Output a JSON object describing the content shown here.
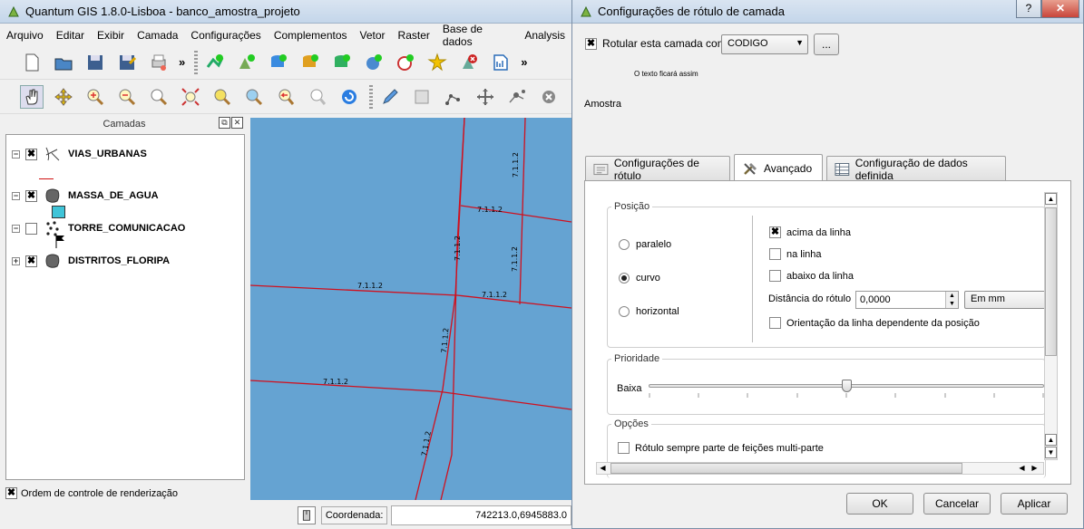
{
  "main_window": {
    "title": "Quantum GIS 1.8.0-Lisboa - banco_amostra_projeto",
    "menu": [
      "Arquivo",
      "Editar",
      "Exibir",
      "Camada",
      "Configurações",
      "Complementos",
      "Vetor",
      "Raster",
      "Base de dados",
      "Analysis"
    ],
    "toolbar1_icons": [
      "new-project-icon",
      "open-project-icon",
      "save-project-icon",
      "save-as-icon",
      "print-composer-icon",
      "add-vector-layer-icon",
      "add-raster-layer-icon",
      "add-postgis-layer-icon",
      "add-spatialite-layer-icon",
      "add-mssql-layer-icon",
      "add-wms-layer-icon",
      "add-wfs-layer-icon",
      "new-shapefile-icon",
      "remove-layer-icon",
      "new-spatialite-icon"
    ],
    "toolbar2_icons": [
      "pan-icon",
      "pan-to-selection-icon",
      "zoom-in-icon",
      "zoom-out-icon",
      "zoom-actual-icon",
      "zoom-full-icon",
      "zoom-to-selection-icon",
      "zoom-to-layer-icon",
      "zoom-last-icon",
      "zoom-next-icon",
      "refresh-icon",
      "toggle-editing-icon",
      "save-edits-icon",
      "add-feature-icon",
      "move-feature-icon",
      "node-tool-icon",
      "delete-selected-icon"
    ],
    "more_glyph": "»",
    "layers_panel": {
      "title": "Camadas",
      "layers": [
        {
          "name": "VIAS_URBANAS",
          "checked": true,
          "checkmark": "✖",
          "icon": "line-layer-icon"
        },
        {
          "name": "MASSA_DE_AGUA",
          "checked": true,
          "checkmark": "✖",
          "icon": "polygon-layer-icon"
        },
        {
          "name": "TORRE_COMUNICACAO",
          "checked": false,
          "checkmark": "",
          "icon": "point-layer-icon"
        },
        {
          "name": "DISTRITOS_FLORIPA",
          "checked": true,
          "checkmark": "✖",
          "icon": "polygon-layer-icon"
        }
      ],
      "render_order_label": "Ordem de controle de renderização",
      "render_order_mark": "✖"
    },
    "map": {
      "background_color": "#65a3d2",
      "line_color": "#d0101e",
      "label_text": "7.1.1.2"
    },
    "status": {
      "coordinate_label": "Coordenada:",
      "coordinate_value": "742213.0,6945883.0"
    }
  },
  "dialog": {
    "title": "Configurações de rótulo de camada",
    "help_glyph": "?",
    "close_glyph": "✕",
    "label_checkbox": {
      "label": "Rotular esta camada com",
      "checked_mark": "✖"
    },
    "field_combo": "CODIGO",
    "expression_button": "...",
    "preview_text": "O texto ficará assim",
    "sample_label": "Amostra",
    "tabs": [
      {
        "label": "Configurações de rótulo",
        "active": false,
        "icon": "text-settings-icon"
      },
      {
        "label": "Avançado",
        "active": true,
        "icon": "tools-icon"
      },
      {
        "label": "Configuração de dados definida",
        "active": false,
        "icon": "data-table-icon"
      }
    ],
    "position_group": {
      "title": "Posição",
      "radios": [
        {
          "label": "paralelo",
          "selected": false
        },
        {
          "label": "curvo",
          "selected": true
        },
        {
          "label": "horizontal",
          "selected": false
        }
      ],
      "checkboxes": [
        {
          "label": "acima da linha",
          "checked": true
        },
        {
          "label": "na linha",
          "checked": false
        },
        {
          "label": "abaixo da linha",
          "checked": false
        }
      ],
      "distance_label": "Distância do rótulo",
      "distance_value": "0,0000",
      "unit_combo": "Em mm",
      "orientation_label": "Orientação da linha dependente da posição",
      "check_mark": "✖"
    },
    "priority_group": {
      "title": "Prioridade",
      "low_label": "Baixa",
      "slider_fraction": 0.5
    },
    "options_group": {
      "title": "Opções",
      "multipart_label": "Rótulo sempre parte de feições multi-parte"
    },
    "buttons": {
      "ok": "OK",
      "cancel": "Cancelar",
      "apply": "Aplicar"
    }
  }
}
